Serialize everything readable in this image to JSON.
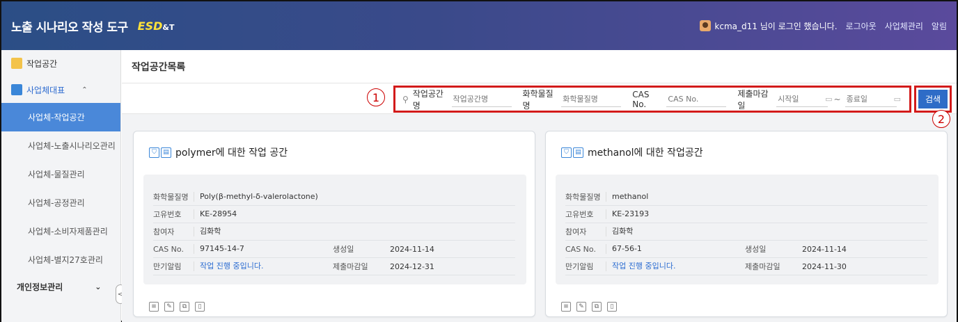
{
  "header": {
    "app_title": "노출 시나리오 작성 도구",
    "brand_main": "ESD",
    "brand_amp": "&T",
    "user_status": "kcma_d11 님이 로그인 했습니다.",
    "logout": "로그아웃",
    "company_mgmt": "사업체관리",
    "alert": "알림"
  },
  "sidebar": {
    "workspace": "작업공간",
    "group_label": "사업체대표",
    "items": [
      {
        "label": "사업체-작업공간"
      },
      {
        "label": "사업체-노출시나리오관리"
      },
      {
        "label": "사업체-물질관리"
      },
      {
        "label": "사업체-공정관리"
      },
      {
        "label": "사업체-소비자제품관리"
      },
      {
        "label": "사업체-별지27호관리"
      }
    ],
    "personal": "개인정보관리",
    "collapse": "<"
  },
  "main": {
    "page_title": "작업공간목록",
    "markers": [
      "1",
      "2"
    ],
    "search": {
      "search_icon": "⚲",
      "ws_label": "작업공간명",
      "ws_placeholder": "작업공간명",
      "chem_label": "화학물질명",
      "chem_placeholder": "화학물질명",
      "cas_label": "CAS No.",
      "cas_placeholder": "CAS No.",
      "deadline_label": "제출마감일",
      "start_placeholder": "시작일",
      "end_placeholder": "종료일",
      "tilde": "~",
      "button": "검색"
    },
    "cards": [
      {
        "title": "polymer에 대한 작업 공간",
        "chem_k": "화학물질명",
        "chem_v": "Poly(β-methyl-δ-valerolactone)",
        "id_k": "고유번호",
        "id_v": "KE-28954",
        "part_k": "참여자",
        "part_v": "김화학",
        "cas_k": "CAS No.",
        "cas_v": "97145-14-7",
        "created_k": "생성일",
        "created_v": "2024-11-14",
        "alert_k": "만기알림",
        "alert_v": "작업 진행 중입니다.",
        "due_k": "제출마감일",
        "due_v": "2024-12-31"
      },
      {
        "title": "methanol에 대한 작업공간",
        "chem_k": "화학물질명",
        "chem_v": "methanol",
        "id_k": "고유번호",
        "id_v": "KE-23193",
        "part_k": "참여자",
        "part_v": "김화학",
        "cas_k": "CAS No.",
        "cas_v": "67-56-1",
        "created_k": "생성일",
        "created_v": "2024-11-14",
        "alert_k": "만기알림",
        "alert_v": "작업 진행 중입니다.",
        "due_k": "제출마감일",
        "due_v": "2024-11-30"
      }
    ]
  },
  "icons": [
    "list-icon",
    "edit-icon",
    "copy-icon",
    "delete-icon",
    "person-icon",
    "doc-icon",
    "calendar-icon"
  ],
  "colors": {
    "header_start": "#2b4e86",
    "header_end": "#5a4a9c",
    "accent": "#2e6cc7",
    "active_nav": "#4a88d9",
    "highlight": "#d21a1a",
    "brand": "#ffe23a"
  }
}
